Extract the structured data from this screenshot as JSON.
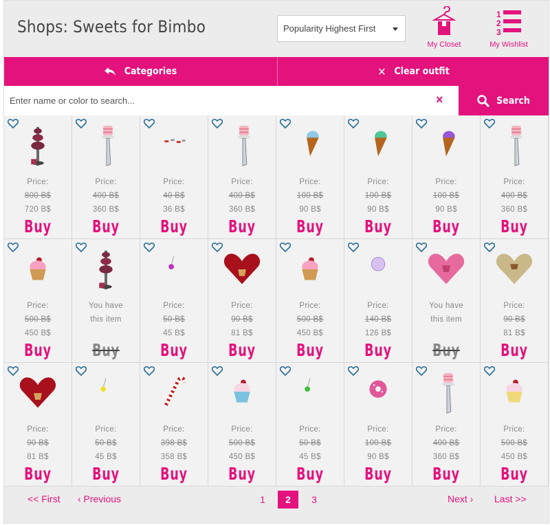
{
  "header": {
    "title": "Shops: Sweets for Bimbo",
    "sort_value": "Popularity Highest First",
    "closet_label": "My Closet",
    "wishlist_label": "My Wishlist"
  },
  "toolbar": {
    "categories_label": "Categories",
    "clear_label": "Clear outfit"
  },
  "search": {
    "placeholder": "Enter name or color to search...",
    "button_label": "Search",
    "clear_symbol": "×"
  },
  "colors": {
    "accent": "#e4127d",
    "panel": "#ececec",
    "cell": "#f2f2f2"
  },
  "items": [
    {
      "thumb": "cake-stand",
      "status": "price",
      "price_label": "Price:",
      "old": "800 B$",
      "new": "720 B$",
      "buy": "Buy"
    },
    {
      "thumb": "cake-bat",
      "status": "price",
      "price_label": "Price:",
      "old": "400 B$",
      "new": "360 B$",
      "buy": "Buy"
    },
    {
      "thumb": "sprinkle",
      "status": "price",
      "price_label": "Price:",
      "old": "40 B$",
      "new": "36 B$",
      "buy": "Buy"
    },
    {
      "thumb": "cake-bat",
      "status": "price",
      "price_label": "Price:",
      "old": "400 B$",
      "new": "360 B$",
      "buy": "Buy"
    },
    {
      "thumb": "cone-blue",
      "status": "price",
      "price_label": "Price:",
      "old": "100 B$",
      "new": "90 B$",
      "buy": "Buy"
    },
    {
      "thumb": "cone-green",
      "status": "price",
      "price_label": "Price:",
      "old": "100 B$",
      "new": "90 B$",
      "buy": "Buy"
    },
    {
      "thumb": "cone-purple",
      "status": "price",
      "price_label": "Price:",
      "old": "100 B$",
      "new": "90 B$",
      "buy": "Buy"
    },
    {
      "thumb": "cake-bat",
      "status": "price",
      "price_label": "Price:",
      "old": "400 B$",
      "new": "360 B$",
      "buy": "Buy"
    },
    {
      "thumb": "cupcake-pink",
      "status": "price",
      "price_label": "Price:",
      "old": "500 B$",
      "new": "450 B$",
      "buy": "Buy"
    },
    {
      "thumb": "cake-stand",
      "status": "owned",
      "owned_1": "You have",
      "owned_2": "this item",
      "buy": "Buy"
    },
    {
      "thumb": "lollipop-purple",
      "status": "price",
      "price_label": "Price:",
      "old": "50 B$",
      "new": "45 B$",
      "buy": "Buy"
    },
    {
      "thumb": "heart-box-red",
      "status": "price",
      "price_label": "Price:",
      "old": "90 B$",
      "new": "81 B$",
      "buy": "Buy"
    },
    {
      "thumb": "cupcake-pink",
      "status": "price",
      "price_label": "Price:",
      "old": "500 B$",
      "new": "450 B$",
      "buy": "Buy"
    },
    {
      "thumb": "bubble",
      "status": "price",
      "price_label": "Price:",
      "old": "140 B$",
      "new": "126 B$",
      "buy": "Buy"
    },
    {
      "thumb": "heart-box-pink",
      "status": "owned",
      "owned_1": "You have",
      "owned_2": "this item",
      "buy": "Buy"
    },
    {
      "thumb": "heart-box-gold",
      "status": "price",
      "price_label": "Price:",
      "old": "90 B$",
      "new": "81 B$",
      "buy": "Buy"
    },
    {
      "thumb": "heart-box-red",
      "status": "price",
      "price_label": "Price:",
      "old": "90 B$",
      "new": "81 B$",
      "buy": "Buy"
    },
    {
      "thumb": "lollipop-yellow",
      "status": "price",
      "price_label": "Price:",
      "old": "50 B$",
      "new": "45 B$",
      "buy": "Buy"
    },
    {
      "thumb": "candy-cane",
      "status": "price",
      "price_label": "Price:",
      "old": "398 B$",
      "new": "358 B$",
      "buy": "Buy"
    },
    {
      "thumb": "cupcake-blue",
      "status": "price",
      "price_label": "Price:",
      "old": "500 B$",
      "new": "450 B$",
      "buy": "Buy"
    },
    {
      "thumb": "lollipop-green",
      "status": "price",
      "price_label": "Price:",
      "old": "50 B$",
      "new": "45 B$",
      "buy": "Buy"
    },
    {
      "thumb": "donut",
      "status": "price",
      "price_label": "Price:",
      "old": "100 B$",
      "new": "90 B$",
      "buy": "Buy"
    },
    {
      "thumb": "cake-bat",
      "status": "price",
      "price_label": "Price:",
      "old": "400 B$",
      "new": "360 B$",
      "buy": "Buy"
    },
    {
      "thumb": "cupcake-yellow",
      "status": "price",
      "price_label": "Price:",
      "old": "500 B$",
      "new": "450 B$",
      "buy": "Buy"
    }
  ],
  "pager": {
    "first": "<< First",
    "previous": "‹ Previous",
    "pages": [
      "1",
      "2",
      "3"
    ],
    "current": "2",
    "next": "Next ›",
    "last": "Last >>"
  }
}
